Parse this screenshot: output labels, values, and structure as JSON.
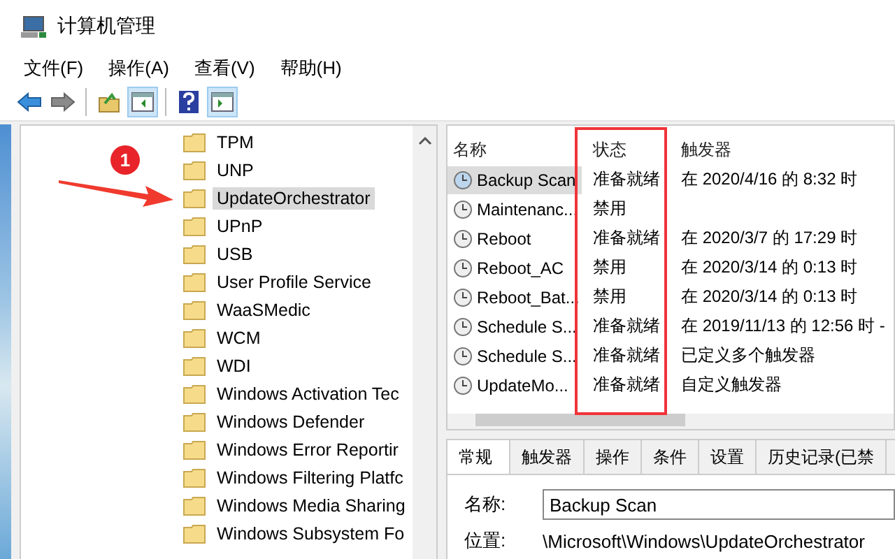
{
  "window": {
    "title": "计算机管理"
  },
  "menu": [
    "文件(F)",
    "操作(A)",
    "查看(V)",
    "帮助(H)"
  ],
  "toolbar": [
    [
      {
        "kind": "back",
        "disabled": false,
        "on": false
      },
      {
        "kind": "forward",
        "disabled": true,
        "on": false
      }
    ],
    [
      {
        "kind": "up",
        "disabled": false,
        "on": false
      },
      {
        "kind": "tree",
        "disabled": false,
        "on": true
      }
    ],
    [
      {
        "kind": "help",
        "disabled": false,
        "on": false
      },
      {
        "kind": "action",
        "disabled": false,
        "on": true
      }
    ]
  ],
  "tree": {
    "items": [
      {
        "label": "TPM",
        "selected": false
      },
      {
        "label": "UNP",
        "selected": false
      },
      {
        "label": "UpdateOrchestrator",
        "selected": true
      },
      {
        "label": "UPnP",
        "selected": false
      },
      {
        "label": "USB",
        "selected": false
      },
      {
        "label": "User Profile Service",
        "selected": false
      },
      {
        "label": "WaaSMedic",
        "selected": false
      },
      {
        "label": "WCM",
        "selected": false
      },
      {
        "label": "WDI",
        "selected": false
      },
      {
        "label": "Windows Activation Tec",
        "selected": false
      },
      {
        "label": "Windows Defender",
        "selected": false
      },
      {
        "label": "Windows Error Reportir",
        "selected": false
      },
      {
        "label": "Windows Filtering Platfc",
        "selected": false
      },
      {
        "label": "Windows Media Sharing",
        "selected": false
      },
      {
        "label": "Windows Subsystem Fo",
        "selected": false
      }
    ]
  },
  "table": {
    "columns": [
      "名称",
      "状态",
      "触发器"
    ],
    "rows": [
      {
        "name": "Backup Scan",
        "status": "准备就绪",
        "trigger": "在 2020/4/16 的 8:32 时",
        "selected": true
      },
      {
        "name": "Maintenanc...",
        "status": "禁用",
        "trigger": "",
        "selected": false
      },
      {
        "name": "Reboot",
        "status": "准备就绪",
        "trigger": "在 2020/3/7 的 17:29 时",
        "selected": false
      },
      {
        "name": "Reboot_AC",
        "status": "禁用",
        "trigger": "在 2020/3/14 的 0:13 时",
        "selected": false
      },
      {
        "name": "Reboot_Bat...",
        "status": "禁用",
        "trigger": "在 2020/3/14 的 0:13 时",
        "selected": false
      },
      {
        "name": "Schedule S...",
        "status": "准备就绪",
        "trigger": "在 2019/11/13 的 12:56 时 -",
        "selected": false
      },
      {
        "name": "Schedule S...",
        "status": "准备就绪",
        "trigger": "已定义多个触发器",
        "selected": false
      },
      {
        "name": "UpdateMo...",
        "status": "准备就绪",
        "trigger": "自定义触发器",
        "selected": false
      }
    ]
  },
  "details": {
    "tabs": [
      {
        "label": "常规",
        "selected": true
      },
      {
        "label": "触发器",
        "selected": false
      },
      {
        "label": "操作",
        "selected": false
      },
      {
        "label": "条件",
        "selected": false
      },
      {
        "label": "设置",
        "selected": false
      },
      {
        "label": "历史记录(已禁",
        "selected": false
      }
    ],
    "fields": [
      {
        "label": "名称:",
        "value": "Backup Scan",
        "kind": "input"
      },
      {
        "label": "位置:",
        "value": "\\Microsoft\\Windows\\UpdateOrchestrator",
        "kind": "text"
      }
    ]
  },
  "annotation": {
    "badge": "1"
  }
}
